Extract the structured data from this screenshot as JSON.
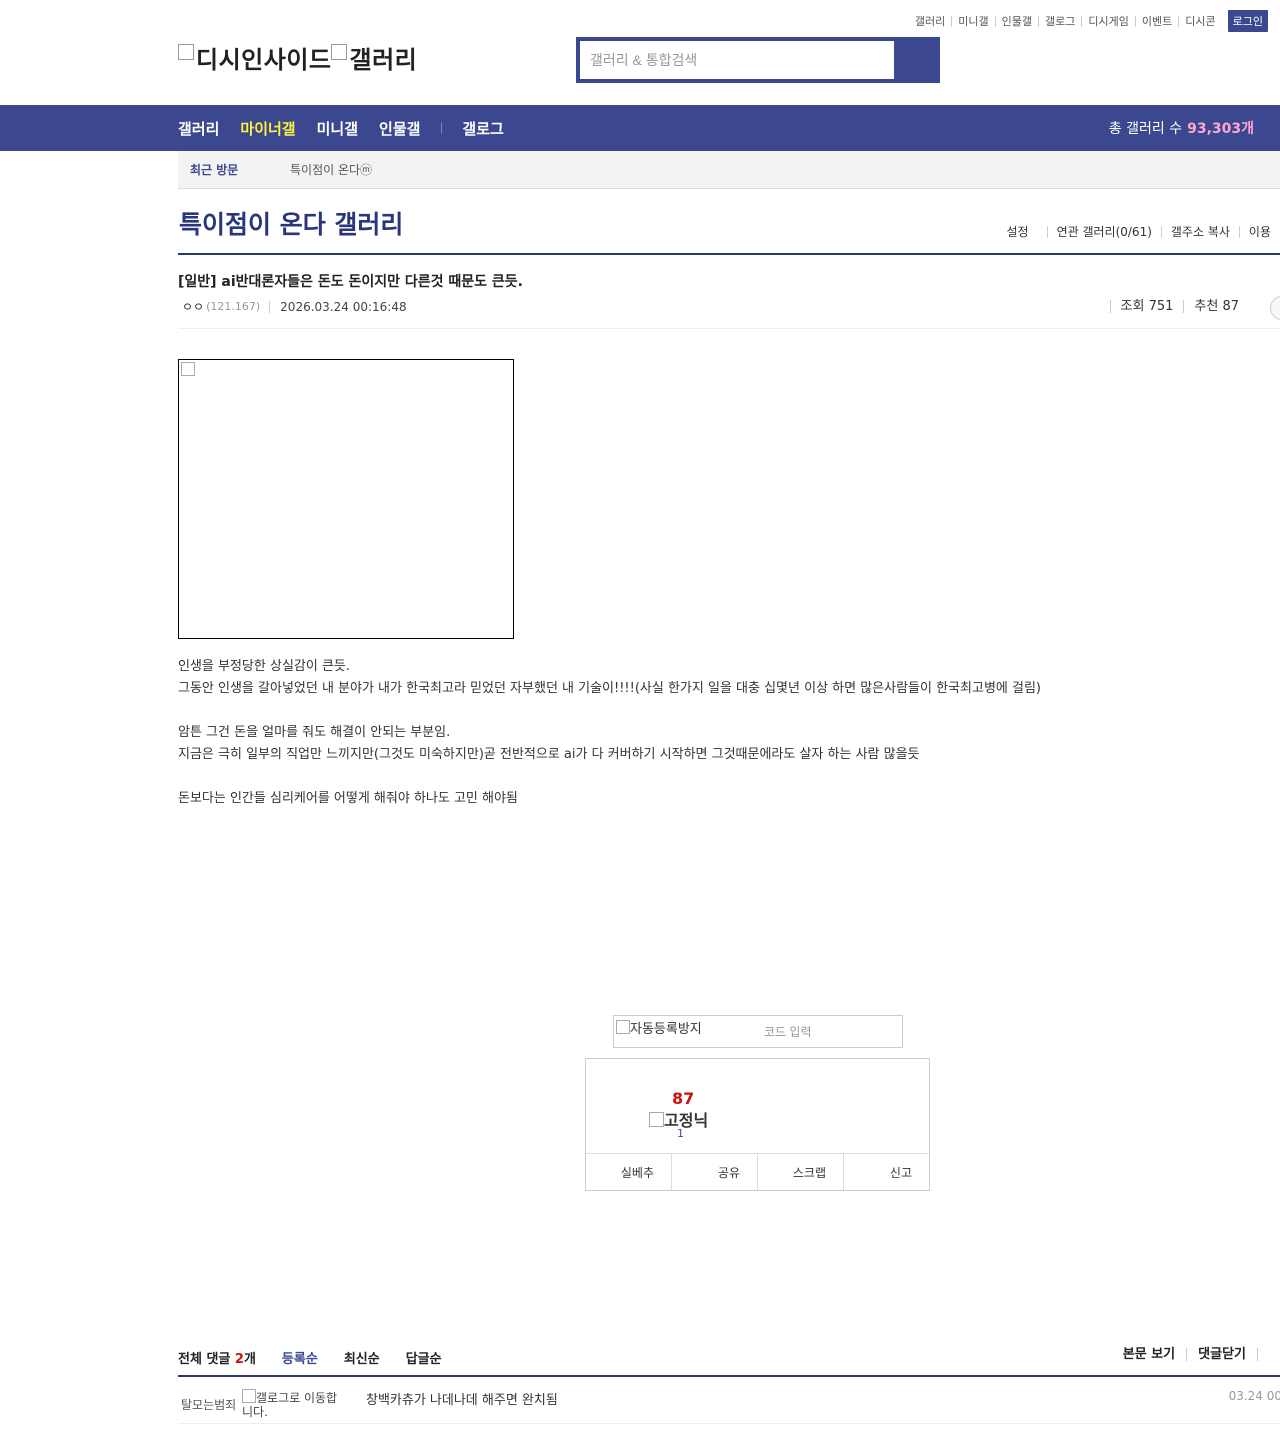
{
  "util_menu": [
    "갤러리",
    "미니갤",
    "인물갤",
    "갤로그",
    "디시게임",
    "이벤트",
    "디시콘"
  ],
  "login_label": "로그인",
  "logo": {
    "alt1": "디시인사이드",
    "alt2": "갤러리"
  },
  "search": {
    "placeholder": "갤러리 & 통합검색"
  },
  "gnb": {
    "items": [
      "갤러리",
      "마이너갤",
      "미니갤",
      "인물갤",
      "갤로그"
    ],
    "active": "마이너갤",
    "total_label": "총 갤러리 수",
    "total_value": "93,303개"
  },
  "recent": {
    "label": "최근 방문",
    "item": "특이점이 온다ⓜ"
  },
  "gallery": {
    "title": "특이점이 온다 갤러리",
    "tools": [
      "설정",
      "연관 갤러리(0/61)",
      "갤주소 복사",
      "이용"
    ]
  },
  "post": {
    "title": "[일반] ai반대론자들은 돈도 돈이지만 다른것 때문도 큰듯.",
    "author": "ㅇㅇ",
    "ip": "(121.167)",
    "datetime": "2026.03.24 00:16:48",
    "views_label": "조회 751",
    "recommend_label": "추천 87",
    "body": [
      "인생을 부정당한 상실감이 큰듯.",
      "그동안 인생을 갈아넣었던 내 분야가 내가 한국최고라 믿었던 자부했던 내 기술이!!!!(사실 한가지 일을 대충 십몇년 이상 하면 많은사람들이 한국최고병에 걸림)",
      "",
      "암튼 그건 돈을 얼마를 줘도 해결이 안되는 부분임.",
      "지금은 극히 일부의 직업만 느끼지만(그것도 미숙하지만)곧 전반적으로 ai가 다 커버하기 시작하면 그것때문에라도 살자 하는 사람 많을듯",
      "",
      "돈보다는 인간들 심리케어를 어떻게 해줘야 하나도 고민 해야됨"
    ]
  },
  "captcha": {
    "alt": "자동등록방지",
    "placeholder": "코드 입력"
  },
  "recommend_box": {
    "count": "87",
    "fixed_alt": "고정닉",
    "fixed_count": "1",
    "buttons": [
      "실베추",
      "공유",
      "스크랩",
      "신고"
    ]
  },
  "comments": {
    "total_label": "전체 댓글",
    "total_count": "2",
    "total_unit": "개",
    "sorts": [
      "등록순",
      "최신순",
      "답글순"
    ],
    "active_sort": "등록순",
    "right_links": [
      "본문 보기",
      "댓글닫기"
    ],
    "items": [
      {
        "nick": "탈모는범죄",
        "galog": "갤로그로 이동합니다.",
        "text": "창백카츄가 나데나데 해주면 완치됨",
        "time": "03.24 00"
      }
    ]
  }
}
